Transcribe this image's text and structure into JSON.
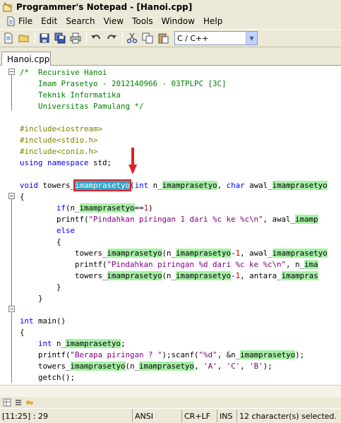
{
  "window": {
    "title": "Programmer's Notepad - [Hanoi.cpp]"
  },
  "menu": [
    "File",
    "Edit",
    "Search",
    "View",
    "Tools",
    "Window",
    "Help"
  ],
  "toolbar": {
    "scheme": "C / C++"
  },
  "tabs": [
    "Hanoi.cpp"
  ],
  "editor": {
    "lines": [
      [
        [
          "c-comment",
          "/*  Recursive Hanoi"
        ]
      ],
      [
        [
          "c-comment",
          "    Imam Prasetyo - 2012140966 - 03TPLPC [3C]"
        ]
      ],
      [
        [
          "c-comment",
          "    Teknik Informatika"
        ]
      ],
      [
        [
          "c-comment",
          "    Universitas Pamulang */"
        ]
      ],
      [
        [
          "",
          ""
        ]
      ],
      [
        [
          "c-pre",
          "#include<iostream>"
        ]
      ],
      [
        [
          "c-pre",
          "#include<stdio.h>"
        ]
      ],
      [
        [
          "c-pre",
          "#include<conio.h>"
        ]
      ],
      [
        [
          "c-kw",
          "using"
        ],
        [
          "",
          " "
        ],
        [
          "c-kw",
          "namespace"
        ],
        [
          "",
          " std;"
        ]
      ],
      [
        [
          "",
          ""
        ]
      ],
      [
        [
          "c-kw",
          "void"
        ],
        [
          "",
          " towers_"
        ],
        [
          "sel",
          "imamprasetyo"
        ],
        [
          "",
          "("
        ],
        [
          "c-kw",
          "int"
        ],
        [
          "",
          " n_"
        ],
        [
          "hl",
          "imamprasetyo"
        ],
        [
          "",
          ", "
        ],
        [
          "c-kw",
          "char"
        ],
        [
          "",
          " awal_"
        ],
        [
          "hl",
          "imamprasetyo"
        ]
      ],
      [
        [
          "",
          "{"
        ]
      ],
      [
        [
          "",
          "        "
        ],
        [
          "c-kw",
          "if"
        ],
        [
          "",
          "(n_"
        ],
        [
          "hl",
          "imamprasetyo"
        ],
        [
          "",
          "=="
        ],
        [
          "c-num",
          "1"
        ],
        [
          "",
          ")"
        ]
      ],
      [
        [
          "",
          "        printf("
        ],
        [
          "c-str",
          "\"Pindahkan piringan 1 dari %c ke %c\\n\""
        ],
        [
          "",
          ", awal_"
        ],
        [
          "hl",
          "imamp"
        ]
      ],
      [
        [
          "",
          "        "
        ],
        [
          "c-kw",
          "else"
        ]
      ],
      [
        [
          "",
          "        {"
        ]
      ],
      [
        [
          "",
          "            towers_"
        ],
        [
          "hl",
          "imamprasetyo"
        ],
        [
          "",
          "(n_"
        ],
        [
          "hl",
          "imamprasetyo"
        ],
        [
          "",
          "-"
        ],
        [
          "c-num",
          "1"
        ],
        [
          "",
          ", awal_"
        ],
        [
          "hl",
          "imamprasetyo"
        ]
      ],
      [
        [
          "",
          "            printf("
        ],
        [
          "c-str",
          "\"Pindahkan piringan %d dari %c ke %c\\n\""
        ],
        [
          "",
          ", n_"
        ],
        [
          "hl",
          "ima"
        ]
      ],
      [
        [
          "",
          "            towers_"
        ],
        [
          "hl",
          "imamprasetyo"
        ],
        [
          "",
          "(n_"
        ],
        [
          "hl",
          "imamprasetyo"
        ],
        [
          "",
          "-"
        ],
        [
          "c-num",
          "1"
        ],
        [
          "",
          ", antara_"
        ],
        [
          "hl",
          "imampras"
        ]
      ],
      [
        [
          "",
          "        }"
        ]
      ],
      [
        [
          "",
          "    }"
        ]
      ],
      [
        [
          "",
          ""
        ]
      ],
      [
        [
          "c-kw",
          "int"
        ],
        [
          "",
          " main()"
        ]
      ],
      [
        [
          "",
          "{"
        ]
      ],
      [
        [
          "",
          "    "
        ],
        [
          "c-kw",
          "int"
        ],
        [
          "",
          " n_"
        ],
        [
          "hl",
          "imamprasetyo"
        ],
        [
          "",
          ";"
        ]
      ],
      [
        [
          "",
          "    printf("
        ],
        [
          "c-str",
          "\"Berapa piringan ? \""
        ],
        [
          "",
          ");scanf("
        ],
        [
          "c-str",
          "\"%d\""
        ],
        [
          "",
          ", &n_"
        ],
        [
          "hl",
          "imamprasetyo"
        ],
        [
          "",
          ");"
        ]
      ],
      [
        [
          "",
          "    towers_"
        ],
        [
          "hl",
          "imamprasetyo"
        ],
        [
          "",
          "(n_"
        ],
        [
          "hl",
          "imamprasetyo"
        ],
        [
          "",
          ", "
        ],
        [
          "c-str",
          "'A'"
        ],
        [
          "",
          ", "
        ],
        [
          "c-str",
          "'C'"
        ],
        [
          "",
          ", "
        ],
        [
          "c-str",
          "'B'"
        ],
        [
          "",
          ");"
        ]
      ],
      [
        [
          "",
          "    getch();"
        ]
      ]
    ]
  },
  "status": {
    "position": "[11:25] : 29",
    "encoding": "ANSI",
    "line_endings": "CR+LF",
    "mode": "INS",
    "selection": "12 character(s) selected."
  },
  "colors": {
    "selection": "#33a3c8",
    "highlight": "#a6f0a6",
    "annotation": "#e0202a"
  }
}
